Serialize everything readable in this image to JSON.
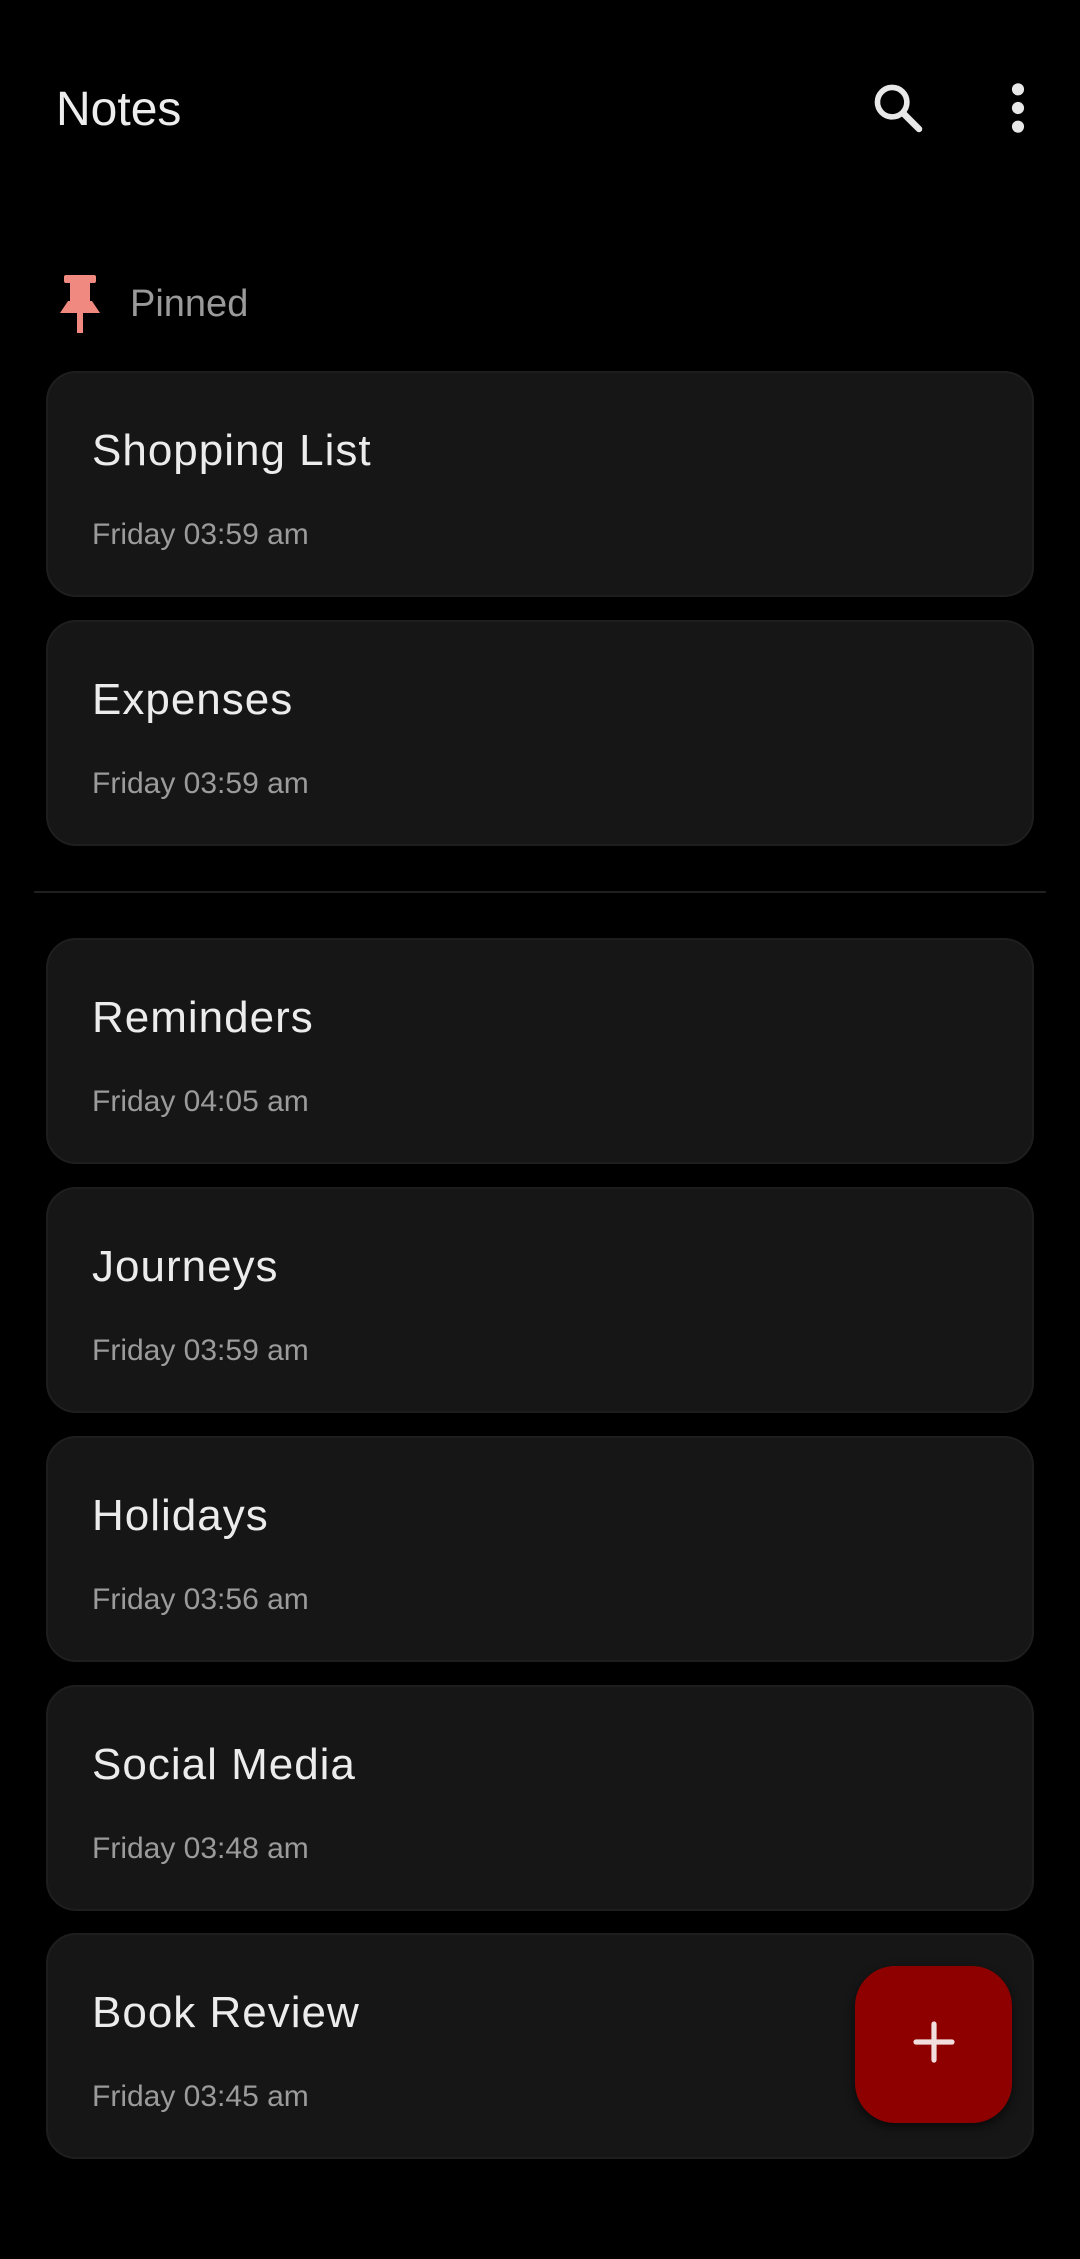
{
  "app_bar": {
    "title": "Notes",
    "search_icon": "search-icon",
    "more_icon": "more-vertical-icon"
  },
  "pinned_section": {
    "icon": "pin-icon",
    "label": "Pinned",
    "accent_color": "#f08a80",
    "notes": [
      {
        "title": "Shopping List",
        "time": "Friday 03:59 am"
      },
      {
        "title": "Expenses",
        "time": "Friday 03:59 am"
      }
    ]
  },
  "notes": [
    {
      "title": "Reminders",
      "time": "Friday 04:05 am"
    },
    {
      "title": "Journeys",
      "time": "Friday 03:59 am"
    },
    {
      "title": "Holidays",
      "time": "Friday 03:56 am"
    },
    {
      "title": "Social Media",
      "time": "Friday 03:48 am"
    },
    {
      "title": "Book Review",
      "time": "Friday 03:45 am"
    }
  ],
  "fab": {
    "icon": "plus-icon",
    "color": "#8e0000"
  }
}
